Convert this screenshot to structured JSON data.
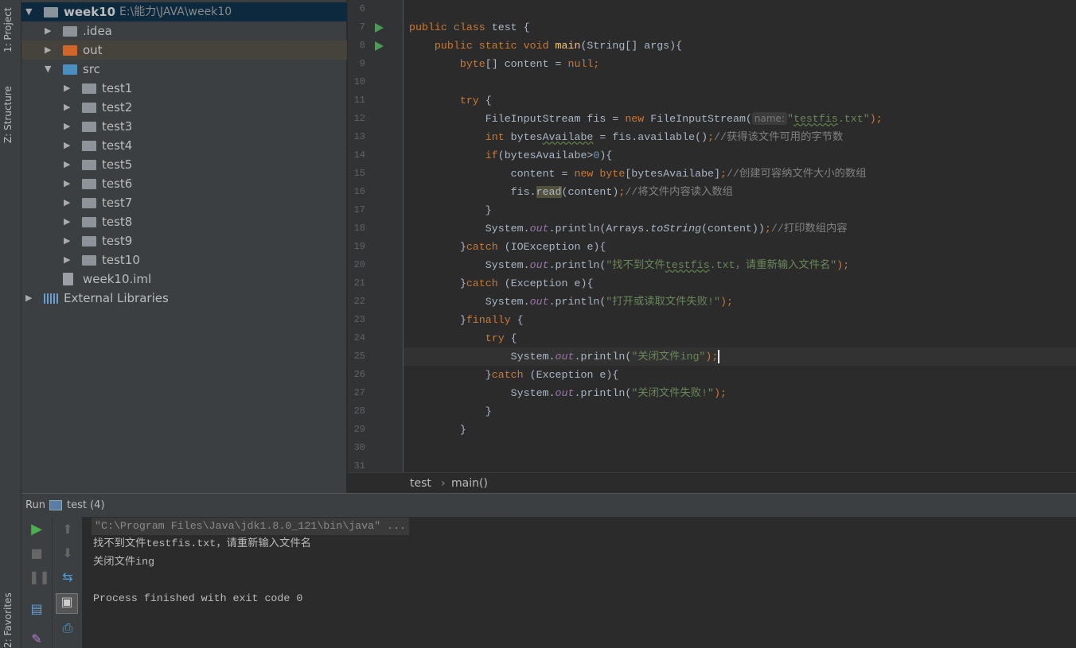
{
  "side_tabs": {
    "project": "1: Project",
    "structure": "Z: Structure",
    "favorites": "2: Favorites"
  },
  "project_tree": [
    {
      "label": "week10",
      "path": "E:\\能力\\JAVA\\week10",
      "level": 0,
      "expanded": true,
      "icon": "module-folder-icon",
      "selected": true
    },
    {
      "label": ".idea",
      "level": 1,
      "expanded": false,
      "icon": "folder-icon"
    },
    {
      "label": "out",
      "level": 1,
      "expanded": false,
      "icon": "excluded-folder-icon",
      "highlighted": true
    },
    {
      "label": "src",
      "level": 1,
      "expanded": true,
      "icon": "source-folder-icon"
    },
    {
      "label": "test1",
      "level": 2,
      "expanded": false,
      "icon": "package-icon"
    },
    {
      "label": "test2",
      "level": 2,
      "expanded": false,
      "icon": "package-icon"
    },
    {
      "label": "test3",
      "level": 2,
      "expanded": false,
      "icon": "package-icon"
    },
    {
      "label": "test4",
      "level": 2,
      "expanded": false,
      "icon": "package-icon"
    },
    {
      "label": "test5",
      "level": 2,
      "expanded": false,
      "icon": "package-icon"
    },
    {
      "label": "test6",
      "level": 2,
      "expanded": false,
      "icon": "package-icon"
    },
    {
      "label": "test7",
      "level": 2,
      "expanded": false,
      "icon": "package-icon"
    },
    {
      "label": "test8",
      "level": 2,
      "expanded": false,
      "icon": "package-icon"
    },
    {
      "label": "test9",
      "level": 2,
      "expanded": false,
      "icon": "package-icon"
    },
    {
      "label": "test10",
      "level": 2,
      "expanded": false,
      "icon": "package-icon"
    },
    {
      "label": "week10.iml",
      "level": 1,
      "icon": "file-icon"
    },
    {
      "label": "External Libraries",
      "level": 0,
      "expanded": false,
      "icon": "libraries-icon"
    }
  ],
  "colors": {
    "keyword": "#cc7832",
    "string": "#6a8759",
    "comment": "#808080",
    "number": "#6897bb",
    "method_decl": "#ffc66d",
    "static_field": "#9876aa",
    "text": "#a9b7c6",
    "run_green": "#499c54"
  },
  "editor": {
    "current_line": 25,
    "run_markers": [
      7,
      8
    ],
    "lines": [
      {
        "n": 6,
        "t": []
      },
      {
        "n": 7,
        "t": [
          [
            "public class ",
            "kw"
          ],
          [
            "test {",
            ""
          ]
        ]
      },
      {
        "n": 8,
        "t": [
          [
            "    public static void ",
            "kw"
          ],
          [
            "main",
            "decl"
          ],
          [
            "(String[] args){",
            ""
          ]
        ]
      },
      {
        "n": 9,
        "t": [
          [
            "        byte",
            "kw"
          ],
          [
            "[] content = ",
            ""
          ],
          [
            "null",
            "kw"
          ],
          [
            ";",
            "kw"
          ]
        ]
      },
      {
        "n": 10,
        "t": []
      },
      {
        "n": 11,
        "t": [
          [
            "        try ",
            "kw"
          ],
          [
            "{",
            ""
          ]
        ]
      },
      {
        "n": 12,
        "t": [
          [
            "            FileInputStream fis = ",
            ""
          ],
          [
            "new ",
            "kw"
          ],
          [
            "FileInputStream(",
            ""
          ],
          [
            "name:",
            "hint"
          ],
          [
            "\"",
            "str"
          ],
          [
            "testfis",
            "str warn"
          ],
          [
            ".txt\"",
            "str"
          ],
          [
            ");",
            "kw"
          ]
        ]
      },
      {
        "n": 13,
        "t": [
          [
            "            int ",
            "kw"
          ],
          [
            "bytes",
            ""
          ],
          [
            "Availabe",
            "warn"
          ],
          [
            " = fis.available()",
            ""
          ],
          [
            ";",
            "kw"
          ],
          [
            "//获得该文件可用的字节数",
            "cmt"
          ]
        ]
      },
      {
        "n": 14,
        "t": [
          [
            "            if",
            "kw"
          ],
          [
            "(bytesAvailabe>",
            ""
          ],
          [
            "0",
            "num"
          ],
          [
            "){",
            ""
          ]
        ]
      },
      {
        "n": 15,
        "t": [
          [
            "                content = ",
            ""
          ],
          [
            "new byte",
            "kw"
          ],
          [
            "[bytesAvailabe]",
            ""
          ],
          [
            ";",
            "kw"
          ],
          [
            "//创建可容纳文件大小的数组",
            "cmt"
          ]
        ]
      },
      {
        "n": 16,
        "t": [
          [
            "                fis.",
            ""
          ],
          [
            "read",
            "hlread"
          ],
          [
            "(content)",
            ""
          ],
          [
            ";",
            "kw"
          ],
          [
            "//将文件内容读入数组",
            "cmt"
          ]
        ]
      },
      {
        "n": 17,
        "t": [
          [
            "            }",
            ""
          ]
        ]
      },
      {
        "n": 18,
        "t": [
          [
            "            System.",
            ""
          ],
          [
            "out",
            "sfield"
          ],
          [
            ".println(Arrays.",
            ""
          ],
          [
            "toString",
            "smeth"
          ],
          [
            "(content))",
            ""
          ],
          [
            ";",
            "kw"
          ],
          [
            "//打印数组内容",
            "cmt"
          ]
        ]
      },
      {
        "n": 19,
        "t": [
          [
            "        }",
            ""
          ],
          [
            "catch ",
            "kw"
          ],
          [
            "(IOException e){",
            ""
          ]
        ]
      },
      {
        "n": 20,
        "t": [
          [
            "            System.",
            ""
          ],
          [
            "out",
            "sfield"
          ],
          [
            ".println(",
            ""
          ],
          [
            "\"找不到文件",
            "str"
          ],
          [
            "testfis",
            "str warn"
          ],
          [
            ".txt，请重新输入文件名\"",
            "str"
          ],
          [
            ");",
            "kw"
          ]
        ]
      },
      {
        "n": 21,
        "t": [
          [
            "        }",
            ""
          ],
          [
            "catch ",
            "kw"
          ],
          [
            "(Exception e){",
            ""
          ]
        ]
      },
      {
        "n": 22,
        "t": [
          [
            "            System.",
            ""
          ],
          [
            "out",
            "sfield"
          ],
          [
            ".println(",
            ""
          ],
          [
            "\"打开或读取文件失败!\"",
            "str"
          ],
          [
            ");",
            "kw"
          ]
        ]
      },
      {
        "n": 23,
        "t": [
          [
            "        }",
            ""
          ],
          [
            "finally ",
            "kw"
          ],
          [
            "{",
            ""
          ]
        ]
      },
      {
        "n": 24,
        "t": [
          [
            "            try ",
            "kw"
          ],
          [
            "{",
            ""
          ]
        ]
      },
      {
        "n": 25,
        "t": [
          [
            "                System.",
            ""
          ],
          [
            "out",
            "sfield"
          ],
          [
            ".println(",
            ""
          ],
          [
            "\"关闭文件ing\"",
            "str"
          ],
          [
            ");",
            "kw"
          ]
        ]
      },
      {
        "n": 26,
        "t": [
          [
            "            }",
            ""
          ],
          [
            "catch ",
            "kw"
          ],
          [
            "(Exception e){",
            ""
          ]
        ]
      },
      {
        "n": 27,
        "t": [
          [
            "                System.",
            ""
          ],
          [
            "out",
            "sfield"
          ],
          [
            ".println(",
            ""
          ],
          [
            "\"关闭文件失败!\"",
            "str"
          ],
          [
            ");",
            "kw"
          ]
        ]
      },
      {
        "n": 28,
        "t": [
          [
            "            }",
            ""
          ]
        ]
      },
      {
        "n": 29,
        "t": [
          [
            "        }",
            ""
          ]
        ]
      },
      {
        "n": 30,
        "t": []
      },
      {
        "n": 31,
        "t": []
      }
    ]
  },
  "breadcrumb": {
    "class": "test",
    "method": "main()"
  },
  "run_panel": {
    "title": "Run",
    "config": "test (4)"
  },
  "console": {
    "command": "\"C:\\Program Files\\Java\\jdk1.8.0_121\\bin\\java\" ...",
    "lines": [
      "找不到文件testfis.txt，请重新输入文件名",
      "关闭文件ing",
      "",
      "Process finished with exit code 0"
    ]
  }
}
